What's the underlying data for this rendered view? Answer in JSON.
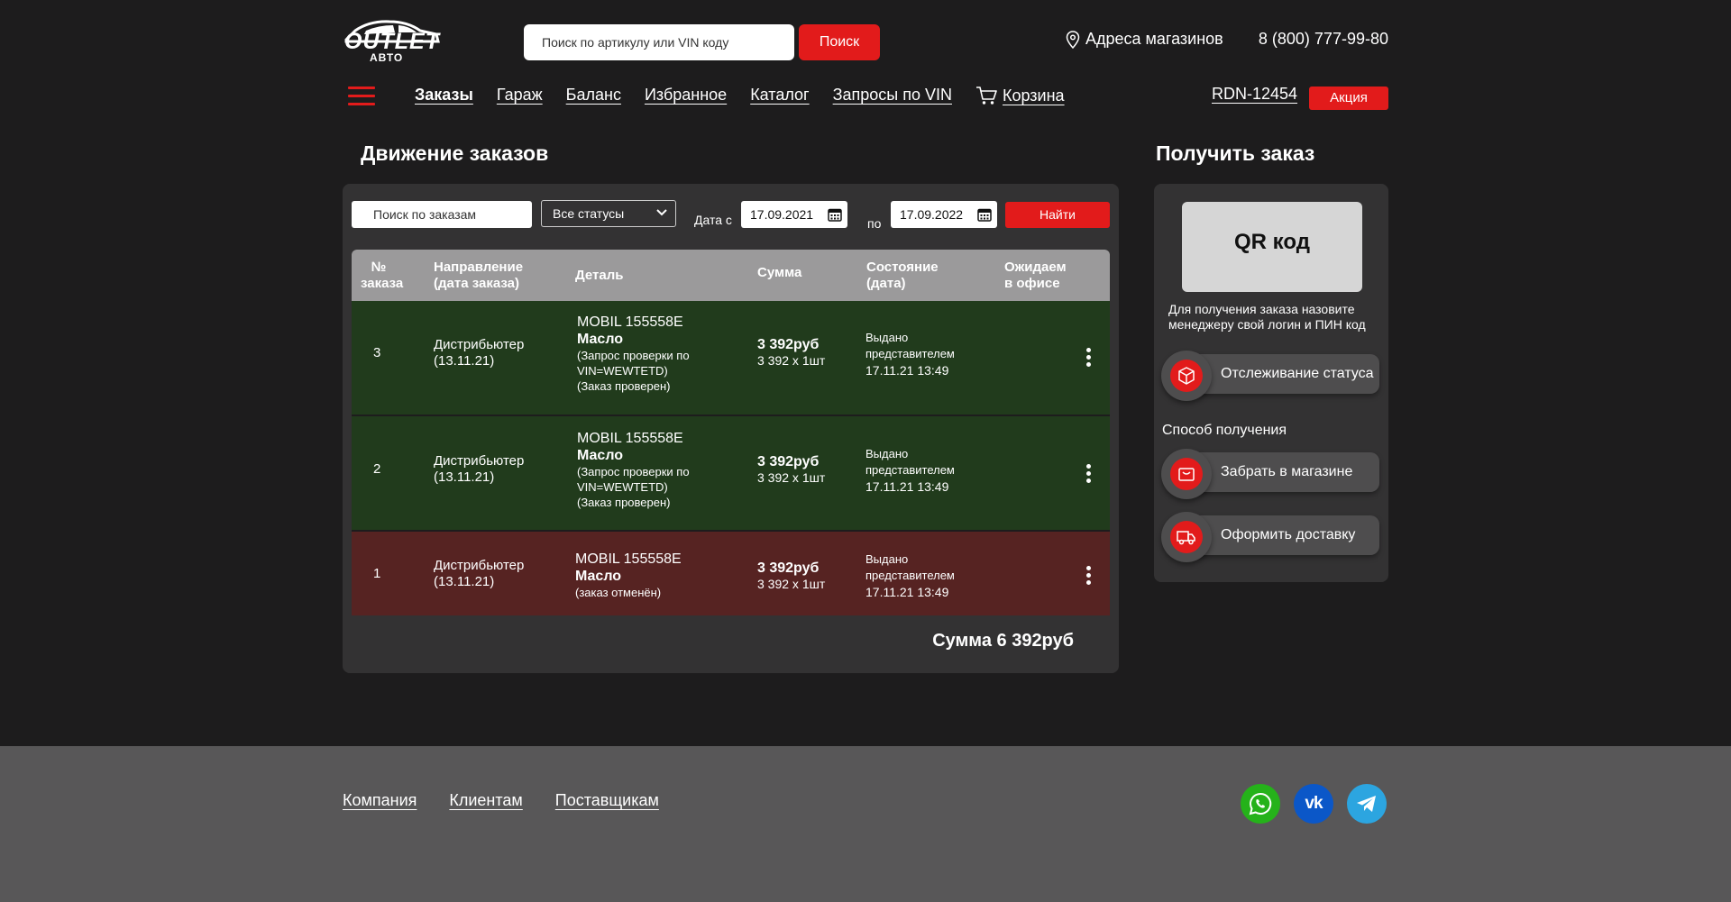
{
  "header": {
    "logo_text": "OUTLET",
    "logo_sub": "АВТО",
    "search_placeholder": "Поиск по артикулу или VIN коду",
    "search_button": "Поиск",
    "addresses": "Адреса магазинов",
    "phone": "8 (800) 777-99-80"
  },
  "nav": {
    "items": [
      {
        "label": "Заказы",
        "active": true
      },
      {
        "label": "Гараж"
      },
      {
        "label": "Баланс"
      },
      {
        "label": "Избранное"
      },
      {
        "label": "Каталог"
      },
      {
        "label": "Запросы по VIN"
      },
      {
        "label": "Корзина"
      }
    ],
    "login": "RDN-12454",
    "promo": "Акция"
  },
  "orders": {
    "title": "Движение заказов",
    "filters": {
      "search_placeholder": "Поиск по заказам",
      "status_selected": "Все статусы",
      "date_from_label": "Дата с",
      "date_from": "17.09.2021",
      "date_to_label": "по",
      "date_to": "17.09.2022",
      "find_button": "Найти"
    },
    "columns": {
      "num_1": "№",
      "num_2": "заказа",
      "dir_1": "Направление",
      "dir_2": "(дата заказа)",
      "detail": "Деталь",
      "sum": "Сумма",
      "state_1": "Состояние",
      "state_2": "(дата)",
      "office_1": "Ожидаем",
      "office_2": "в офисе"
    },
    "rows": [
      {
        "num": "3",
        "direction": "Дистрибьютер",
        "direction_date": "(13.11.21)",
        "brand": "MOBIL 155558E",
        "part": "Масло",
        "note1": "(Запрос проверки по",
        "note2": "VIN=WEWTETD)",
        "note3": "(Заказ проверен)",
        "sum": "3 392руб",
        "sum_detail": "3 392 х 1шт",
        "state1": "Выдано",
        "state2": "представителем",
        "state_date": "17.11.21 13:49",
        "status": "green"
      },
      {
        "num": "2",
        "direction": "Дистрибьютер",
        "direction_date": "(13.11.21)",
        "brand": "MOBIL 155558E",
        "part": "Масло",
        "note1": "(Запрос проверки по",
        "note2": "VIN=WEWTETD)",
        "note3": "(Заказ проверен)",
        "sum": "3 392руб",
        "sum_detail": "3 392 х 1шт",
        "state1": "Выдано",
        "state2": "представителем",
        "state_date": "17.11.21 13:49",
        "status": "green"
      },
      {
        "num": "1",
        "direction": "Дистрибьютер",
        "direction_date": "(13.11.21)",
        "brand": "MOBIL 155558E",
        "part": "Масло",
        "note1": "(заказ отменён)",
        "sum": "3 392руб",
        "sum_detail": "3 392 х 1шт",
        "state1": "Выдано",
        "state2": "представителем",
        "state_date": "17.11.21 13:49",
        "status": "red"
      }
    ],
    "total": "Сумма 6 392руб"
  },
  "receive": {
    "title": "Получить заказ",
    "qr_label": "QR код",
    "hint": "Для получения заказа назовите менеджеру свой логин и ПИН код",
    "track_button": "Отслеживание статуса",
    "method_title": "Способ получения",
    "pickup_button": "Забрать в магазине",
    "delivery_button": "Оформить доставку"
  },
  "footer": {
    "links": [
      "Компания",
      "Клиентам",
      "Поставщикам"
    ],
    "social": [
      "whatsapp-icon",
      "vk-icon",
      "telegram-icon"
    ]
  },
  "colors": {
    "accent": "#e21b1b",
    "row_ok": "#213b1c",
    "row_cancel": "#562322",
    "whatsapp": "#25b21a",
    "vk": "#0b57c8",
    "telegram": "#2ca5e0"
  }
}
